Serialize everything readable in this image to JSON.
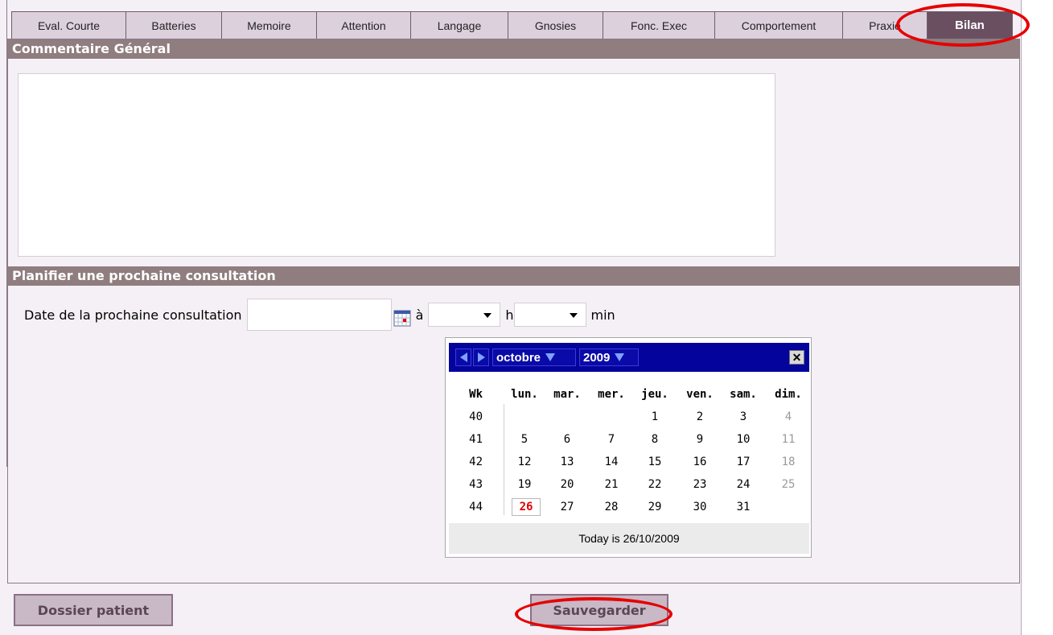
{
  "tabs": [
    {
      "label": "Eval. Courte",
      "active": false
    },
    {
      "label": "Batteries",
      "active": false
    },
    {
      "label": "Memoire",
      "active": false
    },
    {
      "label": "Attention",
      "active": false
    },
    {
      "label": "Langage",
      "active": false
    },
    {
      "label": "Gnosies",
      "active": false
    },
    {
      "label": "Fonc. Exec",
      "active": false
    },
    {
      "label": "Comportement",
      "active": false
    },
    {
      "label": "Praxie",
      "active": false
    },
    {
      "label": "Bilan",
      "active": true
    }
  ],
  "sections": {
    "general_comment": "Commentaire Général",
    "next_consultation": "Planifier une prochaine consultation"
  },
  "comment": {
    "value": ""
  },
  "consultation": {
    "date_label": "Date de la prochaine consultation",
    "date_value": "",
    "at_label": "à",
    "hour_label": "h",
    "minute_label": "min",
    "hour_value": "",
    "minute_value": ""
  },
  "calendar": {
    "month": "octobre",
    "year": "2009",
    "week_header": "Wk",
    "weekdays": [
      "lun.",
      "mar.",
      "mer.",
      "jeu.",
      "ven.",
      "sam.",
      "dim."
    ],
    "weeks": [
      {
        "wk": "40",
        "days": [
          "",
          "",
          "",
          "1",
          "2",
          "3",
          "4"
        ]
      },
      {
        "wk": "41",
        "days": [
          "5",
          "6",
          "7",
          "8",
          "9",
          "10",
          "11"
        ]
      },
      {
        "wk": "42",
        "days": [
          "12",
          "13",
          "14",
          "15",
          "16",
          "17",
          "18"
        ]
      },
      {
        "wk": "43",
        "days": [
          "19",
          "20",
          "21",
          "22",
          "23",
          "24",
          "25"
        ]
      },
      {
        "wk": "44",
        "days": [
          "26",
          "27",
          "28",
          "29",
          "30",
          "31",
          ""
        ]
      }
    ],
    "today_day": "26",
    "footer": "Today is 26/10/2009",
    "close_label": "✕"
  },
  "buttons": {
    "patient_file": "Dossier patient",
    "save": "Sauvegarder"
  },
  "colors": {
    "section_bar": "#8f7d7f",
    "active_tab": "#6a4f60",
    "tab": "#ddd0dd",
    "calendar_header": "#04049c",
    "highlight_ring": "#e60000",
    "today": "#e00000"
  },
  "icons": {
    "calendar_button": "calendar-icon",
    "prev_month": "arrow-left-icon",
    "next_month": "arrow-right-icon",
    "close": "close-icon"
  }
}
